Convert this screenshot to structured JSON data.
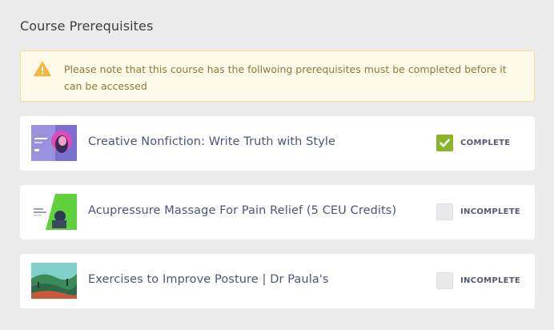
{
  "page": {
    "title": "Course Prerequisites"
  },
  "notice": {
    "icon": "warning-icon",
    "text": "Please note that this course has the follwoing prerequisites must be completed before it can be accessed",
    "colors": {
      "background": "#fdf9e9",
      "border": "#f3dd98",
      "text": "#8e7a3a",
      "icon": "#f0b83f"
    }
  },
  "courses": [
    {
      "title": "Creative Nonfiction: Write Truth with Style",
      "status": "COMPLETE",
      "completed": true
    },
    {
      "title": "Acupressure Massage For Pain Relief (5 CEU Credits)",
      "status": "INCOMPLETE",
      "completed": false
    },
    {
      "title": "Exercises to Improve Posture | Dr Paula's",
      "status": "INCOMPLETE",
      "completed": false
    }
  ],
  "colors": {
    "complete_check": "#8ab429",
    "checkbox_empty": "#e9e9eb"
  }
}
